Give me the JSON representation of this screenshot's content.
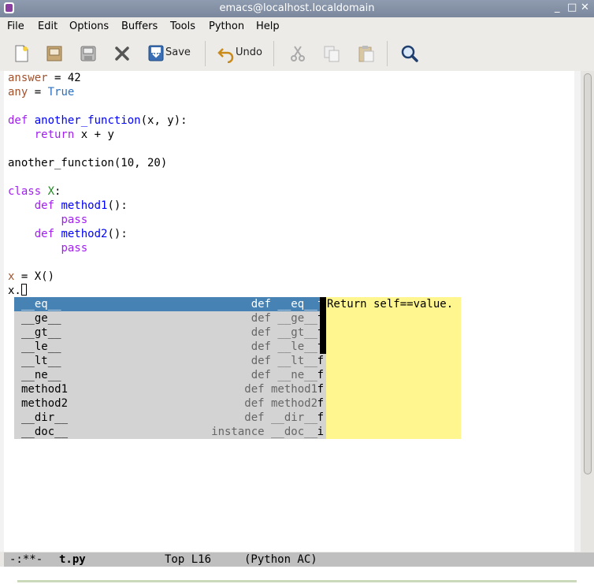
{
  "window": {
    "title": "emacs@localhost.localdomain",
    "controls": [
      "_",
      "□",
      "✕"
    ]
  },
  "menu": [
    "File",
    "Edit",
    "Options",
    "Buffers",
    "Tools",
    "Python",
    "Help"
  ],
  "toolbar": {
    "save_label": "Save",
    "undo_label": "Undo",
    "icons": [
      "new-file-icon",
      "open-folder-icon",
      "save-buffer-icon",
      "close-icon",
      "save-icon",
      "undo-icon",
      "cut-icon",
      "copy-icon",
      "paste-icon",
      "search-icon"
    ]
  },
  "code": {
    "l1": {
      "a": "answer",
      "b": " = 42"
    },
    "l2": {
      "a": "any",
      "b": " = ",
      "c": "True"
    },
    "l4": {
      "kw": "def",
      "fn": "another_function",
      "rest": "(x, y):"
    },
    "l5": {
      "kw": "return",
      "rest": " x + y"
    },
    "l7": "another_function(10, 20)",
    "l9": {
      "kw": "class",
      "cls": "X",
      "rest": ":"
    },
    "l10": {
      "kw": "def",
      "fn": "method1",
      "rest": "():"
    },
    "l11": "pass",
    "l12": {
      "kw": "def",
      "fn": "method2",
      "rest": "():"
    },
    "l13": "pass",
    "l15": {
      "a": "x",
      "b": " = X()"
    },
    "l16": "x."
  },
  "completion": {
    "items": [
      {
        "name": "__eq__",
        "summary": "def __eq__",
        "type": "f"
      },
      {
        "name": "__ge__",
        "summary": "def __ge__",
        "type": "f"
      },
      {
        "name": "__gt__",
        "summary": "def __gt__",
        "type": "f"
      },
      {
        "name": "__le__",
        "summary": "def __le__",
        "type": "f"
      },
      {
        "name": "__lt__",
        "summary": "def __lt__",
        "type": "f"
      },
      {
        "name": "__ne__",
        "summary": "def __ne__",
        "type": "f"
      },
      {
        "name": "method1",
        "summary": "def method1",
        "type": "f"
      },
      {
        "name": "method2",
        "summary": "def method2",
        "type": "f"
      },
      {
        "name": "__dir__",
        "summary": "def __dir__",
        "type": "f"
      },
      {
        "name": "__doc__",
        "summary": "instance __doc__",
        "type": "i"
      }
    ],
    "selected_index": 0,
    "doc": "Return self==value."
  },
  "modeline": {
    "status": "-:**-",
    "buffer": "t.py",
    "position": "Top L16",
    "mode": "(Python AC)"
  },
  "colors": {
    "keyword": "#a020f0",
    "function": "#0000ff",
    "variable": "#a0522d",
    "builtin": "#2f6fbf",
    "selection": "#4682b4",
    "doc_bg": "#fff68f"
  }
}
